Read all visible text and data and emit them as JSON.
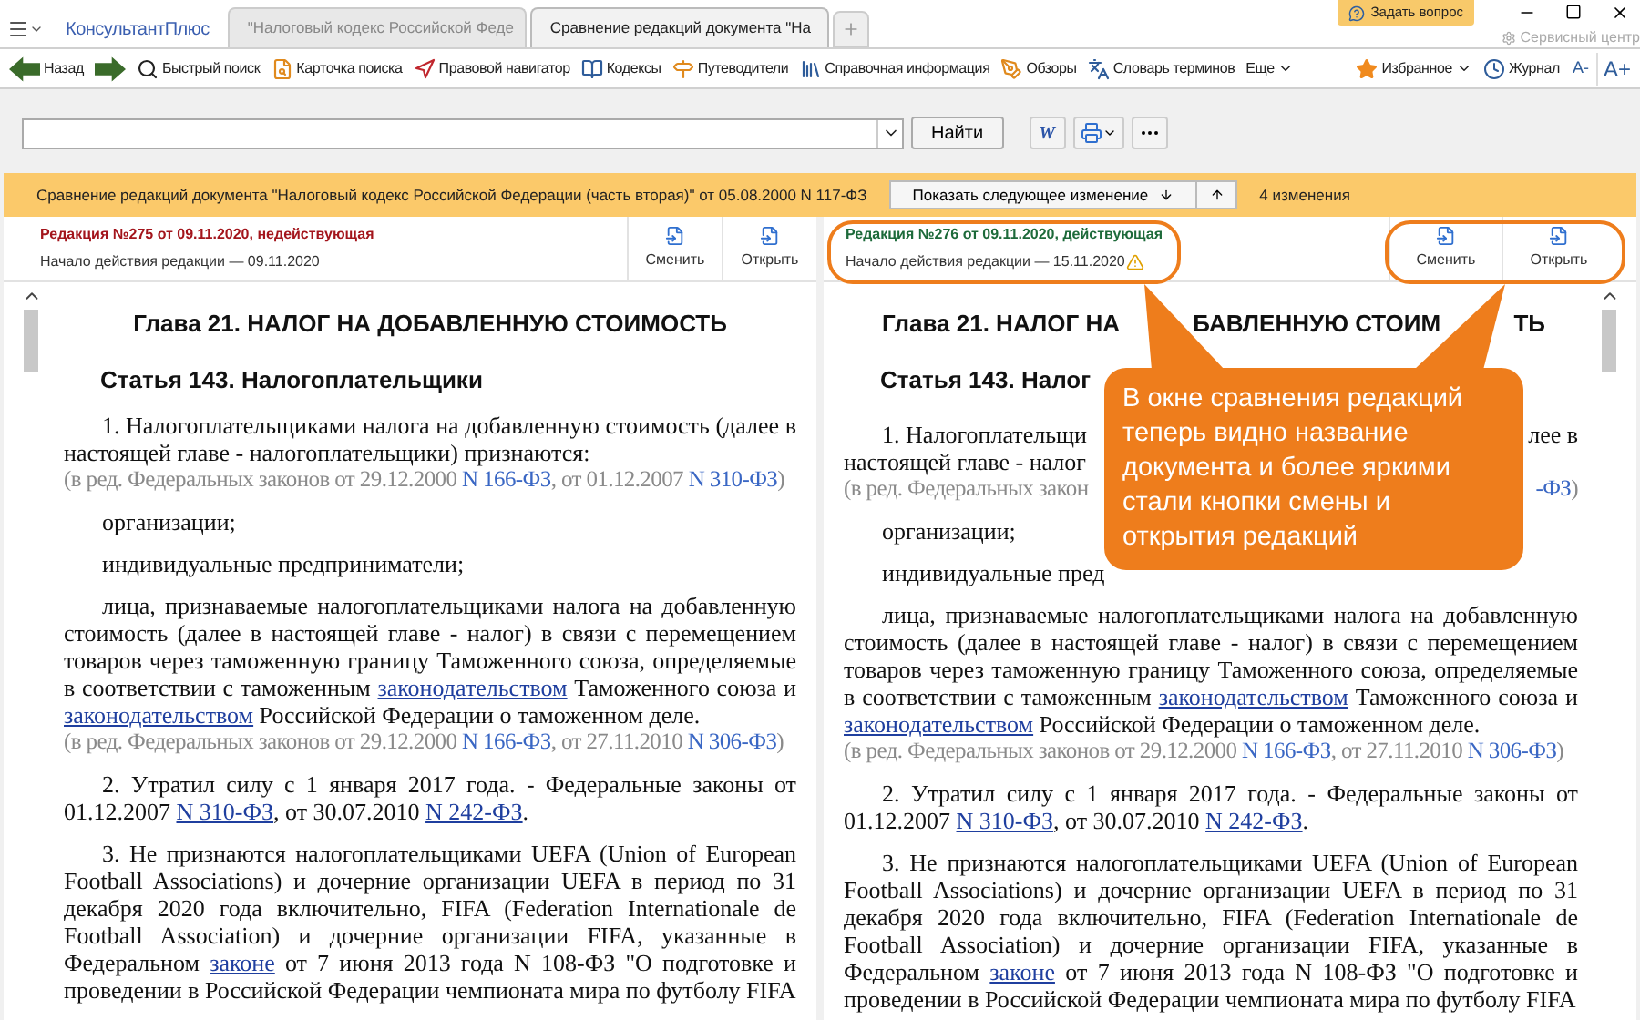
{
  "tab_bar": {
    "logo": "КонсультантПлюс",
    "tabs": [
      {
        "label": "\"Налоговый кодекс Российской Феде",
        "selected": false
      },
      {
        "label": "Сравнение редакций документа \"На",
        "selected": true
      }
    ],
    "ask_button": "Задать вопрос",
    "service_center": "Сервисный центр"
  },
  "toolbar": {
    "items": [
      {
        "label": "Назад",
        "has_menu": false
      },
      {
        "label": "Быстрый поиск",
        "has_menu": false
      },
      {
        "label": "Карточка поиска",
        "has_menu": false
      },
      {
        "label": "Правовой навигатор",
        "has_menu": false
      },
      {
        "label": "Кодексы",
        "has_menu": false
      },
      {
        "label": "Путеводители",
        "has_menu": false
      },
      {
        "label": "Справочная информация",
        "has_menu": false
      },
      {
        "label": "Обзоры",
        "has_menu": false
      },
      {
        "label": "Словарь терминов",
        "has_menu": false
      },
      {
        "label": "Еще",
        "has_menu": true
      }
    ],
    "right_items": [
      {
        "label": "Избранное",
        "has_menu": true
      },
      {
        "label": "Журнал",
        "has_menu": false
      }
    ],
    "font_smaller": "A-",
    "font_larger": "A+"
  },
  "search": {
    "button": "Найти",
    "word_button": "W"
  },
  "compare_bar": {
    "title": "Сравнение редакций документа \"Налоговый кодекс Российской Федерации (часть вторая)\" от 05.08.2000 N 117-ФЗ",
    "next_button": "Показать следующее изменение",
    "changes": "4 изменения"
  },
  "panes": [
    {
      "header": {
        "title": "Редакция №275 от 09.11.2020, недействующая",
        "current": false,
        "start": "Начало действия редакции — 09.11.2020",
        "warning": false,
        "buttons": [
          "Сменить",
          "Открыть"
        ]
      },
      "paragraphs": [
        {
          "kind": "heading",
          "parts": [
            {
              "text": "Глава 21. НАЛОГ НА ДОБАВЛЕННУЮ СТОИМОСТЬ",
              "link": false
            }
          ]
        },
        {
          "kind": "article",
          "parts": [
            {
              "text": "Статья 143. Налогоплательщики",
              "link": false
            }
          ]
        },
        {
          "kind": "body",
          "parts": [
            {
              "text": "1. Налогоплательщиками налога на добавленную стоимость (далее в настоящей главе - налогоплательщики) признаются:",
              "link": false
            }
          ]
        },
        {
          "kind": "note",
          "parts": [
            {
              "text": "(в ред. Федеральных законов от 29.12.2000 ",
              "link": false
            },
            {
              "text": "N 166-ФЗ",
              "link": true
            },
            {
              "text": ", от 01.12.2007 ",
              "link": false
            },
            {
              "text": "N 310-ФЗ",
              "link": true
            },
            {
              "text": ")",
              "link": false
            }
          ]
        },
        {
          "kind": "item",
          "parts": [
            {
              "text": "организации;",
              "link": false
            }
          ]
        },
        {
          "kind": "item",
          "parts": [
            {
              "text": "индивидуальные предприниматели;",
              "link": false
            }
          ]
        },
        {
          "kind": "body",
          "parts": [
            {
              "text": "лица, признаваемые налогоплательщиками налога на добавленную стоимость (далее в настоящей главе - налог) в связи с перемещением товаров через таможенную границу Таможенного союза, определяемые в соответствии с таможенным ",
              "link": false
            },
            {
              "text": "законодательством",
              "link": true
            },
            {
              "text": " Таможенного союза и ",
              "link": false
            },
            {
              "text": "законодательством",
              "link": true
            },
            {
              "text": " Российской Федерации о таможенном деле.",
              "link": false
            }
          ]
        },
        {
          "kind": "note",
          "parts": [
            {
              "text": "(в ред. Федеральных законов от 29.12.2000 ",
              "link": false
            },
            {
              "text": "N 166-ФЗ",
              "link": true
            },
            {
              "text": ", от 27.11.2010 ",
              "link": false
            },
            {
              "text": "N 306-ФЗ",
              "link": true
            },
            {
              "text": ")",
              "link": false
            }
          ]
        },
        {
          "kind": "body",
          "parts": [
            {
              "text": "2. Утратил силу с 1 января 2017 года. - Федеральные законы от 01.12.2007 ",
              "link": false
            },
            {
              "text": "N 310-ФЗ",
              "link": true
            },
            {
              "text": ", от 30.07.2010 ",
              "link": false
            },
            {
              "text": "N 242-ФЗ",
              "link": true
            },
            {
              "text": ".",
              "link": false
            }
          ]
        },
        {
          "kind": "body",
          "parts": [
            {
              "text": "3. Не признаются налогоплательщиками UEFA (Union of European Football Associations) и дочерние организации UEFA в период по 31 декабря 2020 года включительно, FIFA (Federation Internationale de Football Association) и дочерние организации FIFA, указанные в Федеральном ",
              "link": false
            },
            {
              "text": "законе",
              "link": true
            },
            {
              "text": " от 7 июня 2013 года N 108-ФЗ \"О подготовке и проведении в Российской Федерации чемпионата мира по футболу FIFA",
              "link": false
            }
          ]
        }
      ]
    },
    {
      "header": {
        "title": "Редакция №276 от 09.11.2020, действующая",
        "current": true,
        "start": "Начало действия редакции — 15.11.2020",
        "warning": true,
        "buttons": [
          "Сменить",
          "Открыть"
        ]
      },
      "paragraphs": [
        {
          "kind": "heading_cut",
          "lines": [
            {
              "segments": [
                {
                  "parts": [
                    {
                      "text": "Глава 21. НАЛОГ НА",
                      "link": false
                    }
                  ]
                },
                {
                  "parts": [
                    {
                      "text": "БАВЛЕННУЮ СТОИМ",
                      "link": false
                    }
                  ]
                },
                {
                  "parts": [
                    {
                      "text": "ТЬ",
                      "link": false
                    }
                  ]
                }
              ]
            }
          ]
        },
        {
          "kind": "article_cut",
          "lines": [
            {
              "segments": [
                {
                  "parts": [
                    {
                      "text": "Статья 143. Налог",
                      "link": false
                    }
                  ]
                }
              ]
            }
          ]
        },
        {
          "kind": "body_cut",
          "lines": [
            {
              "segments": [
                {
                  "parts": [
                    {
                      "text": "1. Налогоплательщи",
                      "link": false
                    }
                  ]
                },
                {
                  "parts": [
                    {
                      "text": "лее в",
                      "link": false
                    }
                  ]
                }
              ]
            },
            {
              "segments": [
                {
                  "parts": [
                    {
                      "text": "настоящей главе - налог",
                      "link": false
                    }
                  ]
                }
              ]
            }
          ]
        },
        {
          "kind": "note_cut",
          "lines": [
            {
              "segments": [
                {
                  "parts": [
                    {
                      "text": "(в ред. Федеральных закон",
                      "link": false
                    }
                  ]
                },
                {
                  "parts": [
                    {
                      "text": "-ФЗ",
                      "link": true
                    },
                    {
                      "text": ")",
                      "link": false
                    }
                  ]
                }
              ]
            }
          ]
        },
        {
          "kind": "item",
          "parts": [
            {
              "text": "организации;",
              "link": false
            }
          ]
        },
        {
          "kind": "item_cut",
          "lines": [
            {
              "segments": [
                {
                  "parts": [
                    {
                      "text": "индивидуальные пред",
                      "link": false
                    }
                  ]
                }
              ]
            }
          ]
        },
        {
          "kind": "body",
          "parts": [
            {
              "text": "лица, признаваемые налогоплательщиками налога на добавленную стоимость (далее в настоящей главе - налог) в связи с перемещением товаров через таможенную границу Таможенного союза, определяемые в соответствии с таможенным ",
              "link": false
            },
            {
              "text": "законодательством",
              "link": true
            },
            {
              "text": " Таможенного союза и ",
              "link": false
            },
            {
              "text": "законодательством",
              "link": true
            },
            {
              "text": " Российской Федерации о таможенном деле.",
              "link": false
            }
          ]
        },
        {
          "kind": "note",
          "parts": [
            {
              "text": "(в ред. Федеральных законов от 29.12.2000 ",
              "link": false
            },
            {
              "text": "N 166-ФЗ",
              "link": true
            },
            {
              "text": ", от 27.11.2010 ",
              "link": false
            },
            {
              "text": "N 306-ФЗ",
              "link": true
            },
            {
              "text": ")",
              "link": false
            }
          ]
        },
        {
          "kind": "body",
          "parts": [
            {
              "text": "2. Утратил силу с 1 января 2017 года. - Федеральные законы от 01.12.2007 ",
              "link": false
            },
            {
              "text": "N 310-ФЗ",
              "link": true
            },
            {
              "text": ", от 30.07.2010 ",
              "link": false
            },
            {
              "text": "N 242-ФЗ",
              "link": true
            },
            {
              "text": ".",
              "link": false
            }
          ]
        },
        {
          "kind": "body",
          "parts": [
            {
              "text": "3. Не признаются налогоплательщиками UEFA (Union of European Football Associations) и дочерние организации UEFA в период по 31 декабря 2020 года включительно, FIFA (Federation Internationale de Football Association) и дочерние организации FIFA, указанные в Федеральном ",
              "link": false
            },
            {
              "text": "законе",
              "link": true
            },
            {
              "text": " от 7 июня 2013 года N 108-ФЗ \"О подготовке и проведении в Российской Федерации чемпионата мира по футболу FIFA",
              "link": false
            }
          ]
        }
      ]
    }
  ],
  "callout": {
    "text": "В окне сравнения редакций теперь видно название документа и более яркими стали кнопки смены и открытия редакций"
  }
}
